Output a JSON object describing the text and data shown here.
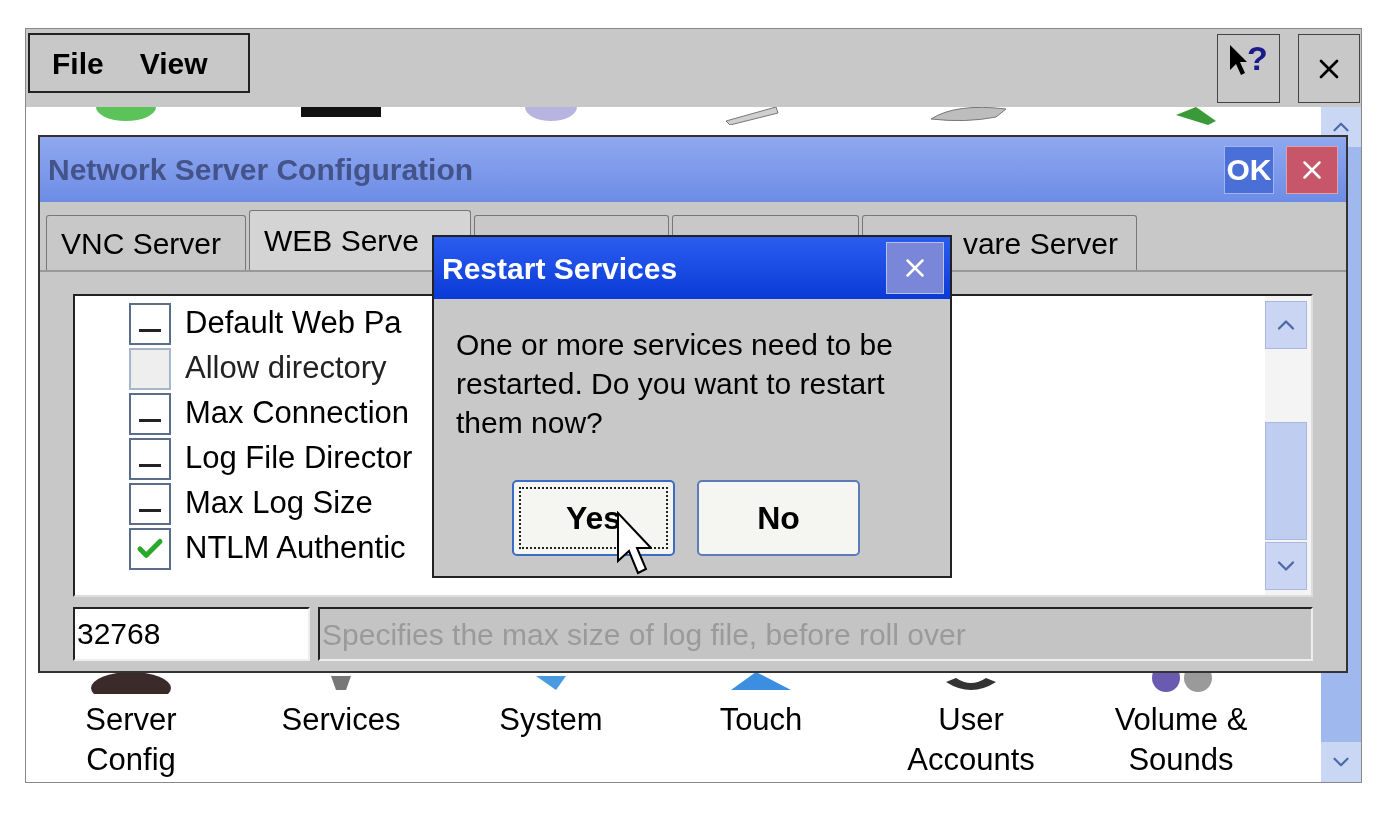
{
  "menu": [
    {
      "label": "File"
    },
    {
      "label": "View"
    }
  ],
  "help_button": {
    "label": "?"
  },
  "control_panel": {
    "items": [
      {
        "label": "Server Config"
      },
      {
        "label": "Services"
      },
      {
        "label": "System"
      },
      {
        "label": "Touch"
      },
      {
        "label": "User Accounts"
      },
      {
        "label": "Volume & Sounds"
      }
    ]
  },
  "config_dialog": {
    "title": "Network Server Configuration",
    "ok": "OK",
    "tabs": [
      {
        "label": "VNC Server",
        "selected": false
      },
      {
        "label": "WEB Serve",
        "selected": true
      },
      {
        "selected": false
      },
      {
        "selected": false
      },
      {
        "label": "vare Server",
        "selected": false
      }
    ],
    "options": [
      {
        "label": "Default Web Pa",
        "checked": false,
        "disabled": false
      },
      {
        "label": "Allow directory",
        "checked": false,
        "disabled": true
      },
      {
        "label": "Max Connection",
        "checked": false,
        "disabled": false
      },
      {
        "label": "Log File Director",
        "checked": false,
        "disabled": false
      },
      {
        "label": "Max Log Size",
        "checked": false,
        "disabled": false
      },
      {
        "label": "NTLM Authentic",
        "checked": true,
        "disabled": false
      }
    ],
    "value": "32768",
    "description": "Specifies the max size of log file, before roll over"
  },
  "restart_dialog": {
    "title": "Restart Services",
    "message": "One or more services need to be restarted. Do you want to restart them now?",
    "buttons": [
      {
        "label": "Yes",
        "focused": true
      },
      {
        "label": "No",
        "focused": false
      }
    ]
  }
}
